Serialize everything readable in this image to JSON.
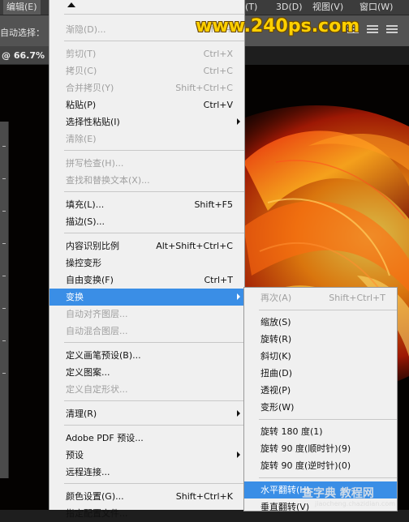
{
  "menubar": {
    "items": [
      {
        "label": "编辑(E)",
        "id": "edit"
      },
      {
        "label": "(T)",
        "id": "type"
      },
      {
        "label": "3D(D)",
        "id": "3d"
      },
      {
        "label": "视图(V)",
        "id": "view"
      },
      {
        "label": "窗口(W)",
        "id": "window"
      }
    ]
  },
  "options_bar": {
    "auto_select_label": "自动选择："
  },
  "document": {
    "zoom": "@ 66.7%"
  },
  "watermark": {
    "site": "www.240ps.com",
    "cz_text": "查字典 教程网",
    "cz_url": "jiaocheng.chazidian.com"
  },
  "colors": {
    "menu_bg": "#f0f0f0",
    "highlight": "#3a8ee6",
    "disabled_text": "#a0a0a0",
    "watermark_yellow": "#ffd000"
  },
  "edit_menu": {
    "items": [
      {
        "label": "渐隐(D)...",
        "shortcut": "Shift+",
        "disabled": true
      },
      {
        "label": "剪切(T)",
        "shortcut": "Ctrl+X",
        "disabled": true
      },
      {
        "label": "拷贝(C)",
        "shortcut": "Ctrl+C",
        "disabled": true
      },
      {
        "label": "合并拷贝(Y)",
        "shortcut": "Shift+Ctrl+C",
        "disabled": true
      },
      {
        "label": "粘贴(P)",
        "shortcut": "Ctrl+V",
        "disabled": false
      },
      {
        "label": "选择性粘贴(I)",
        "shortcut": "",
        "disabled": false,
        "submenu": true
      },
      {
        "label": "清除(E)",
        "shortcut": "",
        "disabled": true
      },
      {
        "label": "拼写检查(H)...",
        "shortcut": "",
        "disabled": true
      },
      {
        "label": "查找和替换文本(X)...",
        "shortcut": "",
        "disabled": true
      },
      {
        "label": "填充(L)...",
        "shortcut": "Shift+F5",
        "disabled": false
      },
      {
        "label": "描边(S)...",
        "shortcut": "",
        "disabled": false
      },
      {
        "label": "内容识别比例",
        "shortcut": "Alt+Shift+Ctrl+C",
        "disabled": false
      },
      {
        "label": "操控变形",
        "shortcut": "",
        "disabled": false
      },
      {
        "label": "自由变换(F)",
        "shortcut": "Ctrl+T",
        "disabled": false
      },
      {
        "label": "变换",
        "shortcut": "",
        "disabled": false,
        "submenu": true,
        "highlighted": true
      },
      {
        "label": "自动对齐图层...",
        "shortcut": "",
        "disabled": true
      },
      {
        "label": "自动混合图层...",
        "shortcut": "",
        "disabled": true
      },
      {
        "label": "定义画笔预设(B)...",
        "shortcut": "",
        "disabled": false
      },
      {
        "label": "定义图案...",
        "shortcut": "",
        "disabled": false
      },
      {
        "label": "定义自定形状...",
        "shortcut": "",
        "disabled": true
      },
      {
        "label": "清理(R)",
        "shortcut": "",
        "disabled": false,
        "submenu": true
      },
      {
        "label": "Adobe PDF 预设...",
        "shortcut": "",
        "disabled": false
      },
      {
        "label": "预设",
        "shortcut": "",
        "disabled": false,
        "submenu": true
      },
      {
        "label": "远程连接...",
        "shortcut": "",
        "disabled": false
      },
      {
        "label": "颜色设置(G)...",
        "shortcut": "Shift+Ctrl+K",
        "disabled": false
      },
      {
        "label": "指定配置文件...",
        "shortcut": "",
        "disabled": false
      }
    ]
  },
  "transform_submenu": {
    "items": [
      {
        "label": "再次(A)",
        "shortcut": "Shift+Ctrl+T",
        "disabled": true
      },
      {
        "label": "缩放(S)",
        "shortcut": "",
        "disabled": false
      },
      {
        "label": "旋转(R)",
        "shortcut": "",
        "disabled": false
      },
      {
        "label": "斜切(K)",
        "shortcut": "",
        "disabled": false
      },
      {
        "label": "扭曲(D)",
        "shortcut": "",
        "disabled": false
      },
      {
        "label": "透视(P)",
        "shortcut": "",
        "disabled": false
      },
      {
        "label": "变形(W)",
        "shortcut": "",
        "disabled": false
      },
      {
        "label": "旋转 180 度(1)",
        "shortcut": "",
        "disabled": false
      },
      {
        "label": "旋转 90 度(顺时针)(9)",
        "shortcut": "",
        "disabled": false
      },
      {
        "label": "旋转 90 度(逆时针)(0)",
        "shortcut": "",
        "disabled": false
      },
      {
        "label": "水平翻转(H)",
        "shortcut": "",
        "disabled": false,
        "highlighted": true
      },
      {
        "label": "垂直翻转(V)",
        "shortcut": "",
        "disabled": false
      }
    ]
  }
}
